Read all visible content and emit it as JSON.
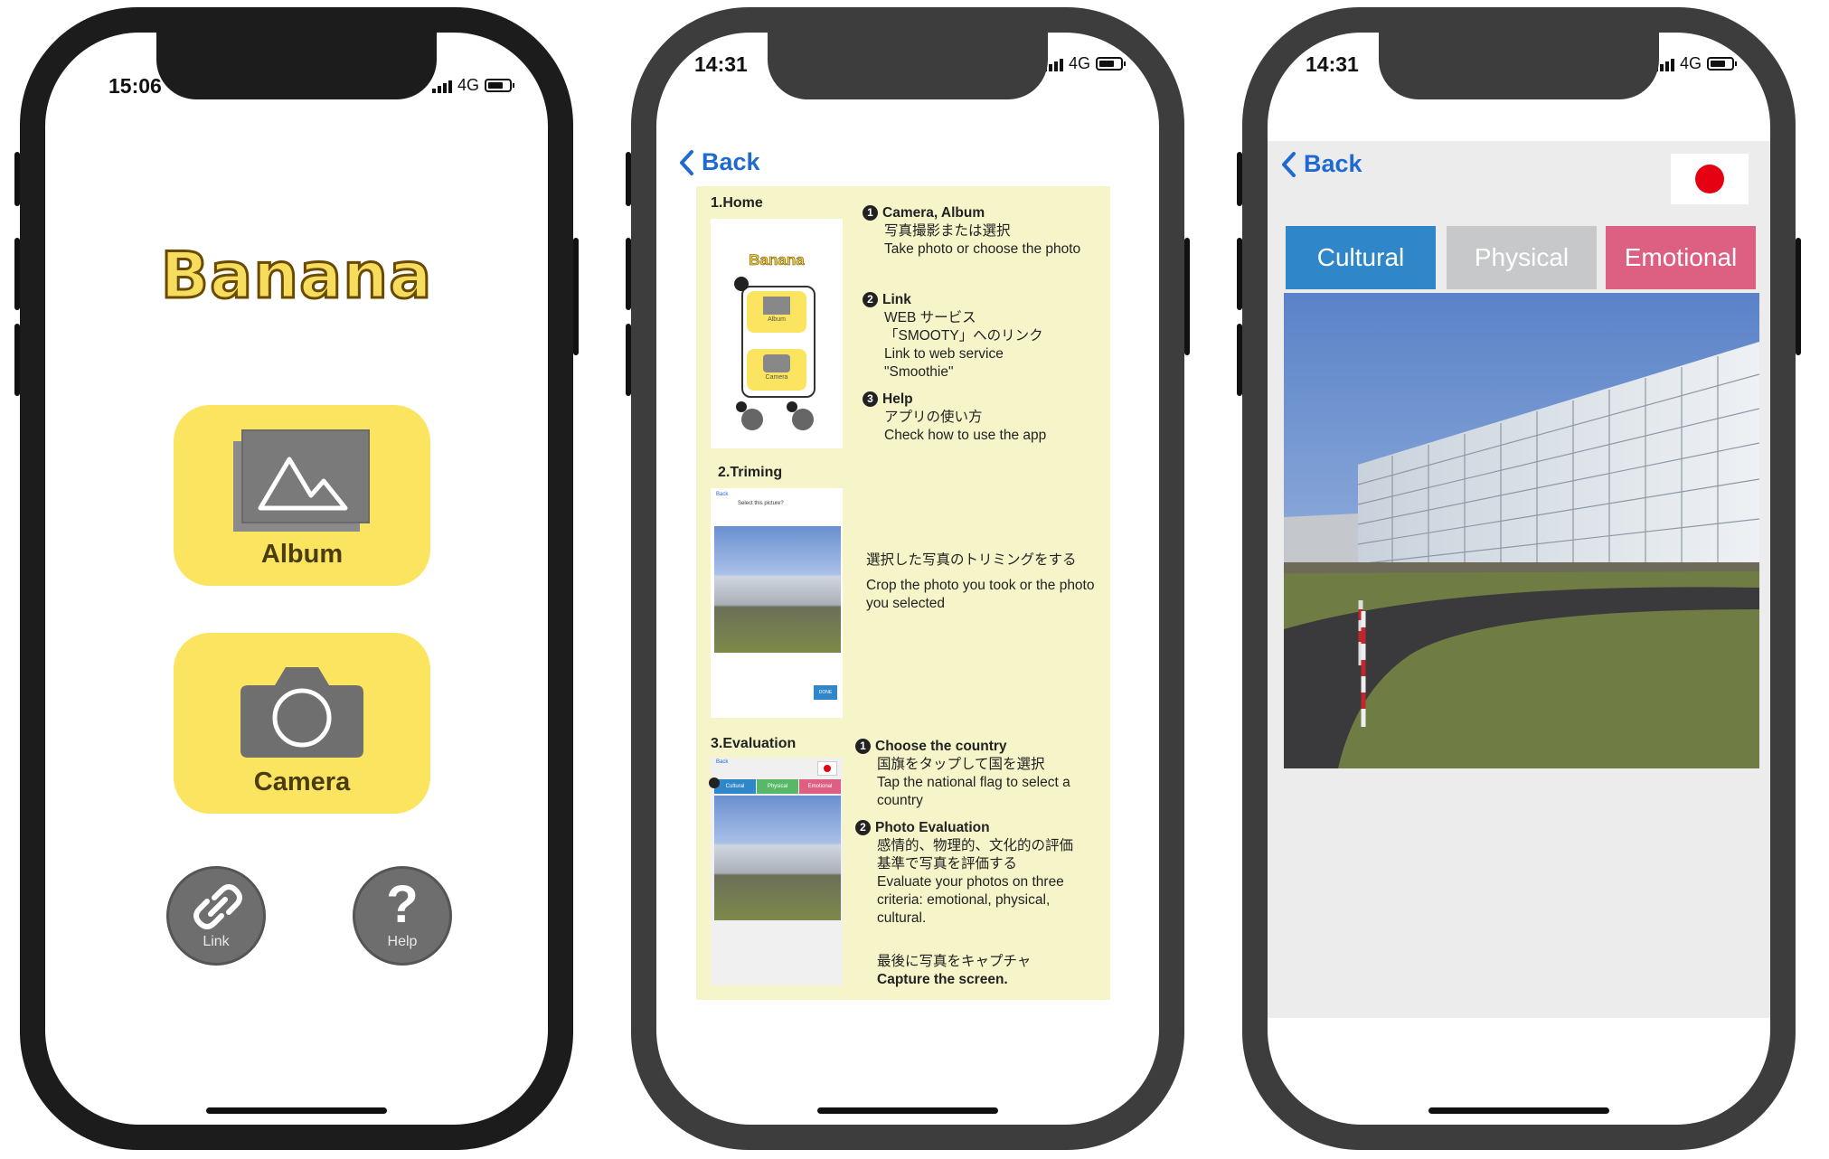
{
  "phone1": {
    "status": {
      "time": "15:06",
      "network": "4G"
    },
    "logo": "Banana",
    "album_label": "Album",
    "camera_label": "Camera",
    "link_label": "Link",
    "help_label": "Help",
    "help_glyph": "?"
  },
  "phone2": {
    "status": {
      "time": "14:31",
      "network": "4G"
    },
    "back_label": "Back",
    "guide": {
      "sec1_title": "1.Home",
      "sec1_thumb_logo": "Banana",
      "sec1_thumb_album": "Album",
      "sec1_thumb_camera": "Camera",
      "item1_title": "Camera, Album",
      "item1_jp": "写真撮影または選択",
      "item1_en": "Take photo or choose the photo",
      "item2_title": "Link",
      "item2_jp": "WEB サービス「SMOOTY」へのリンク",
      "item2_en": "Link to web service \"Smoothie\"",
      "item3_title": "Help",
      "item3_jp": "アプリの使い方",
      "item3_en": "Check how to use the app",
      "sec2_title": "2.Triming",
      "sec2_thumb_back": "Back",
      "sec2_thumb_question": "Select this picture?",
      "sec2_thumb_done": "DONE",
      "sec2_jp": "選択した写真のトリミングをする",
      "sec2_en": "Crop the photo you took or the photo you selected",
      "sec3_title": "3.Evaluation",
      "sec3_thumb_back": "Back",
      "sec3_thumb_tabs": [
        "Cultural",
        "Physical",
        "Emotional"
      ],
      "item4_title": "Choose the country",
      "item4_jp": "国旗をタップして国を選択",
      "item4_en": "Tap the national flag to select a country",
      "item5_title": "Photo Evaluation",
      "item5_jp": "感情的、物理的、文化的の評価基準で写真を評価する",
      "item5_en": "Evaluate your photos on three criteria: emotional, physical, cultural.",
      "capture_jp": "最後に写真をキャプチャ",
      "capture_en": "Capture the screen."
    }
  },
  "phone3": {
    "status": {
      "time": "14:31",
      "network": "4G"
    },
    "back_label": "Back",
    "tabs": [
      {
        "label": "Cultural",
        "color": "#2f86c9"
      },
      {
        "label": "Physical",
        "color": "#c7c8ca"
      },
      {
        "label": "Emotional",
        "color": "#dd5f82"
      }
    ],
    "flag_color": "#e50012"
  },
  "colors": {
    "app_yellow": "#fbe460",
    "link_blue": "#1f6ad1",
    "guide_bg": "#f6f5ca"
  }
}
